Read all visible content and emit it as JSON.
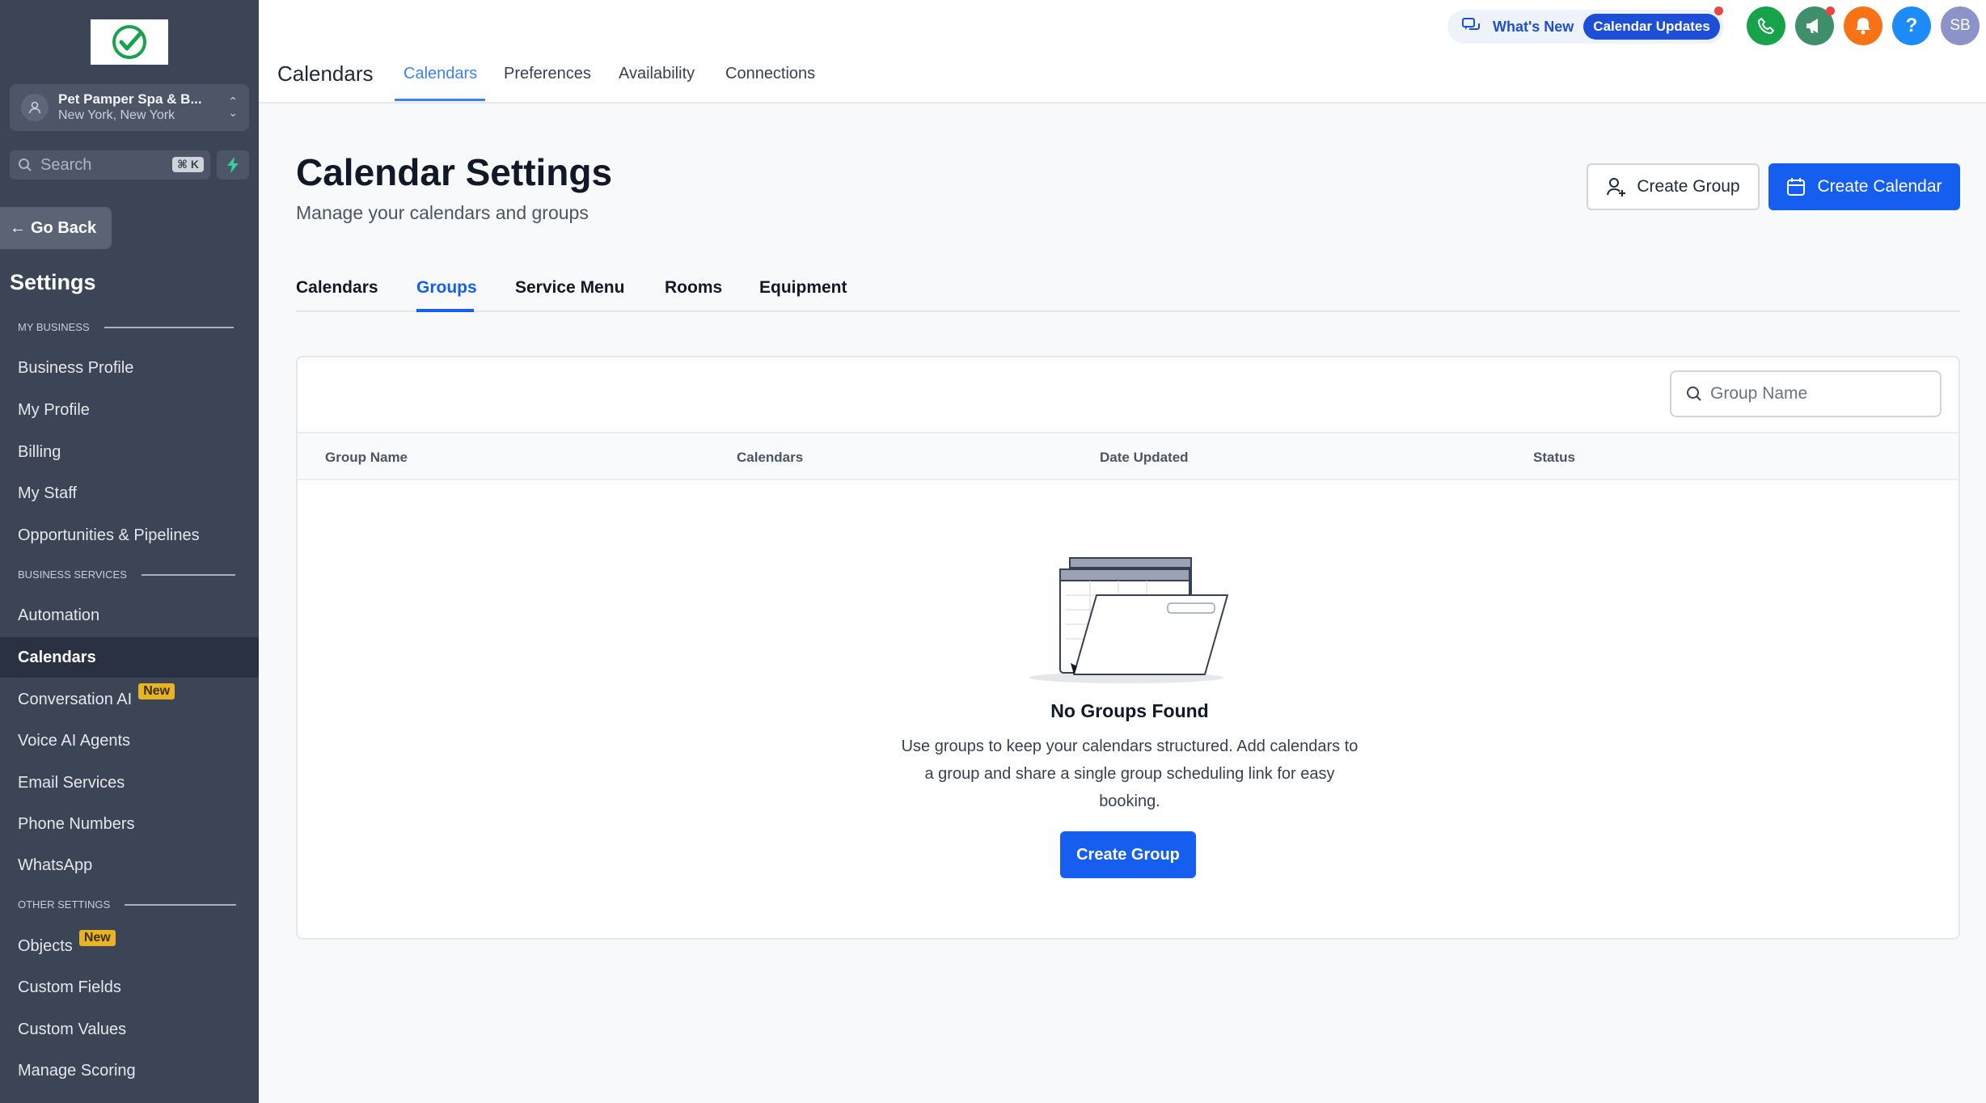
{
  "sidebar": {
    "account": {
      "name": "Pet Pamper Spa & B...",
      "location": "New York, New York"
    },
    "search": {
      "placeholder": "Search",
      "shortcut": "⌘ K"
    },
    "go_back": "Go Back",
    "title": "Settings",
    "sections": {
      "my_business": "MY BUSINESS",
      "business_services": "BUSINESS SERVICES",
      "other_settings": "OTHER SETTINGS"
    },
    "items": [
      {
        "label": "Business Profile"
      },
      {
        "label": "My Profile"
      },
      {
        "label": "Billing"
      },
      {
        "label": "My Staff"
      },
      {
        "label": "Opportunities & Pipelines"
      },
      {
        "label": "Automation"
      },
      {
        "label": "Calendars",
        "active": true
      },
      {
        "label": "Conversation AI",
        "badge": "New"
      },
      {
        "label": "Voice AI Agents"
      },
      {
        "label": "Email Services"
      },
      {
        "label": "Phone Numbers"
      },
      {
        "label": "WhatsApp"
      },
      {
        "label": "Objects",
        "badge": "New"
      },
      {
        "label": "Custom Fields"
      },
      {
        "label": "Custom Values"
      },
      {
        "label": "Manage Scoring"
      }
    ]
  },
  "topbar": {
    "heading": "Calendars",
    "tabs": [
      "Calendars",
      "Preferences",
      "Availability",
      "Connections"
    ],
    "active_tab": "Calendars",
    "whats_new": "What's New",
    "updates_pill": "Calendar Updates",
    "avatar_initials": "SB",
    "help_glyph": "?"
  },
  "main": {
    "title": "Calendar Settings",
    "subtitle": "Manage your calendars and groups",
    "create_group": "Create Group",
    "create_calendar": "Create Calendar",
    "subtabs": [
      "Calendars",
      "Groups",
      "Service Menu",
      "Rooms",
      "Equipment"
    ],
    "active_subtab": "Groups",
    "search_placeholder": "Group Name",
    "columns": [
      "Group Name",
      "Calendars",
      "Date Updated",
      "Status"
    ],
    "empty": {
      "title": "No Groups Found",
      "description": "Use groups to keep your calendars structured. Add calendars to a group and share a single group scheduling link for easy booking.",
      "button": "Create Group"
    }
  },
  "colors": {
    "sidebar_bg": "#3c4555",
    "primary": "#155eef",
    "tab_active": "#3b82f6",
    "badge_new": "#e8b425"
  }
}
